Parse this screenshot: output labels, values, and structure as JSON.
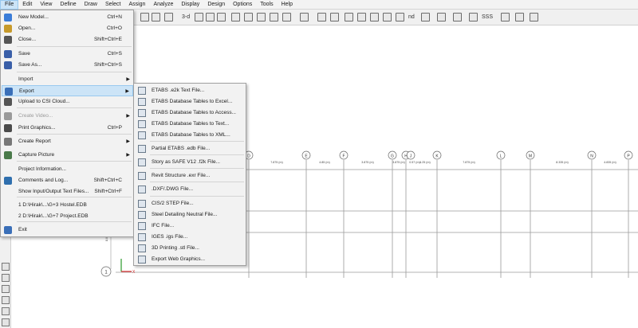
{
  "menubar": [
    "File",
    "Edit",
    "View",
    "Define",
    "Draw",
    "Select",
    "Assign",
    "Analyze",
    "Display",
    "Design",
    "Options",
    "Tools",
    "Help"
  ],
  "toolbar": {
    "view_3d_label": "3-d",
    "nd_label": "nd",
    "sss_label": "SSS"
  },
  "file_menu": {
    "items": [
      {
        "label": "New Model...",
        "shortcut": "Ctrl+N",
        "icon": "new-model-icon"
      },
      {
        "label": "Open...",
        "shortcut": "Ctrl+O",
        "icon": "open-folder-icon"
      },
      {
        "label": "Close...",
        "shortcut": "Shift+Ctrl+E",
        "icon": "close-icon"
      },
      {
        "label": "Save",
        "shortcut": "Ctrl+S",
        "icon": "save-icon"
      },
      {
        "label": "Save As...",
        "shortcut": "Shift+Ctrl+S",
        "icon": "save-as-icon"
      },
      {
        "label": "Import",
        "shortcut": "",
        "icon": "",
        "submenu": true
      },
      {
        "label": "Export",
        "shortcut": "",
        "icon": "export-icon",
        "submenu": true
      },
      {
        "label": "Upload to CSI Cloud...",
        "shortcut": "",
        "icon": "cloud-upload-icon"
      },
      {
        "label": "Create Video...",
        "shortcut": "",
        "icon": "video-icon",
        "submenu": true,
        "disabled": true
      },
      {
        "label": "Print Graphics...",
        "shortcut": "Ctrl+P",
        "icon": "print-icon"
      },
      {
        "label": "Create Report",
        "shortcut": "",
        "icon": "report-icon",
        "submenu": true
      },
      {
        "label": "Capture Picture",
        "shortcut": "",
        "icon": "capture-picture-icon",
        "submenu": true
      },
      {
        "label": "Project Information...",
        "shortcut": "",
        "icon": ""
      },
      {
        "label": "Comments and Log...",
        "shortcut": "Shift+Ctrl+C",
        "icon": "comments-icon"
      },
      {
        "label": "Show Input/Output Text Files...",
        "shortcut": "Shift+Ctrl+F",
        "icon": ""
      },
      {
        "label": "1 D:\\Hirak\\...\\G+3 Hostel.EDB",
        "shortcut": "",
        "icon": ""
      },
      {
        "label": "2 D:\\Hirak\\...\\G+7 Project.EDB",
        "shortcut": "",
        "icon": ""
      },
      {
        "label": "Exit",
        "shortcut": "",
        "icon": "exit-icon"
      }
    ]
  },
  "export_submenu": {
    "items": [
      "ETABS .e2k Text File...",
      "ETABS Database Tables to Excel...",
      "ETABS Database Tables to Access...",
      "ETABS Database Tables to Text...",
      "ETABS Database Tables to XML...",
      "Partial ETABS .edb File...",
      "Story as SAFE V12 .f2k File...",
      "Revit Structure .exr File...",
      ".DXF/.DWG File...",
      "CIS/2 STEP File...",
      "Steel Detailing Neutral File...",
      "IFC File...",
      "IGES .igs File...",
      "3D Printing .stl File...",
      "Export Web Graphics..."
    ]
  },
  "grid": {
    "bubbles": [
      "D",
      "E",
      "F",
      "G",
      "H",
      "J",
      "K",
      "L",
      "M",
      "N",
      "P"
    ],
    "dims": [
      "7.875 (m)",
      "4.85 (m)",
      "3.875 (m)",
      "3.875 (m)",
      "0.57 (m)",
      "4.25 (m)",
      "7.875 (m)",
      "8.335 (m)",
      "4.835 (m)"
    ],
    "row_bubble": "1",
    "side_dim": "8.035 (m)"
  },
  "colors": {
    "accent_highlight": "#cce4f7",
    "accent_border": "#99c9ef",
    "grid_line": "#9a9a9a"
  }
}
